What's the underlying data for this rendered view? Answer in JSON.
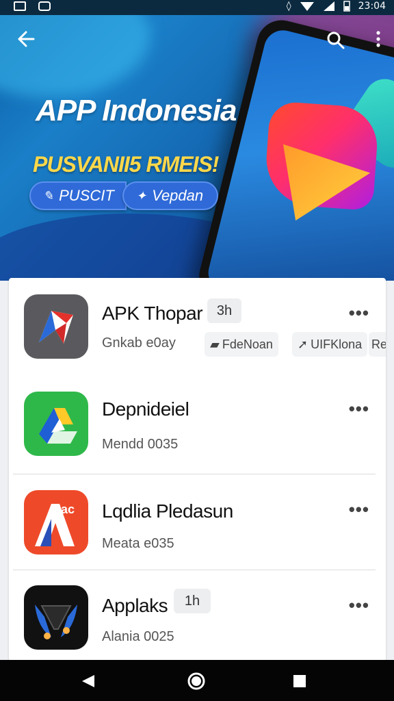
{
  "status_bar": {
    "time": "23:04"
  },
  "hero": {
    "title": "APP Indonesia",
    "subtitle": "PUSVANII5 RMEIS!",
    "button_left": "PUSCIT",
    "button_right": "Vepdan",
    "accent_color": "#ffd84a"
  },
  "apps": [
    {
      "name": "APK Thopar",
      "badge": "3h",
      "meta": "Gnkab e0ay",
      "chips": [
        "FdeNoan",
        "UIFKlona",
        "Re"
      ]
    },
    {
      "name": "Depnideiel",
      "badge": "",
      "meta": "Mendd 0035",
      "chips": []
    },
    {
      "name": "Lqdlia Pledasun",
      "badge": "",
      "meta": "Meata e035",
      "chips": []
    },
    {
      "name": "Applaks",
      "badge": "1h",
      "meta": "Alania 0025",
      "chips": []
    }
  ],
  "more_glyph": "•••",
  "icons": [
    "back-arrow-icon",
    "search-icon",
    "overflow-menu-icon",
    "nav-back-icon",
    "nav-home-icon",
    "nav-recents-icon"
  ]
}
